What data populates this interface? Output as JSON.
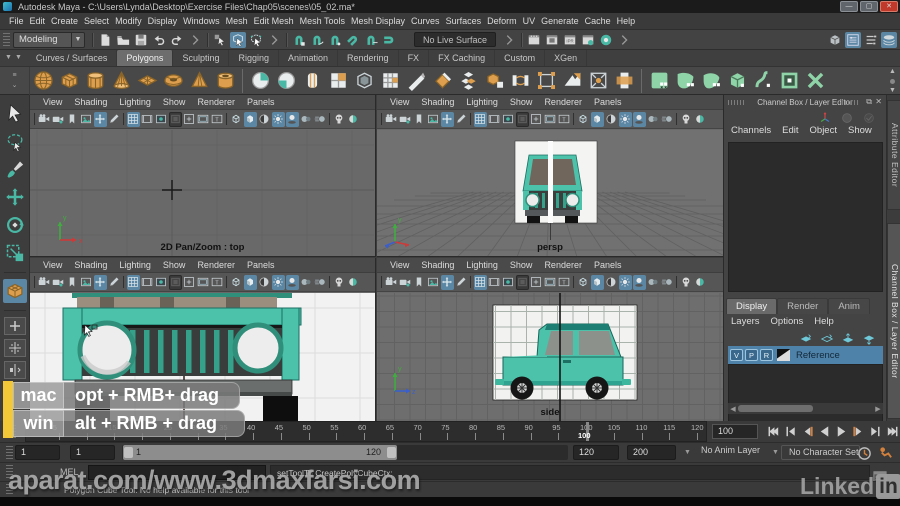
{
  "colors": {
    "teal": "#49b8a5",
    "car_teal": "#4cc2aa",
    "accent_blue": "#5b87a5",
    "orange": "#dd9e4d",
    "overlay_yellow": "#f2c738"
  },
  "title_bar": {
    "app_icon": "maya-logo",
    "title": "Autodesk Maya - C:\\Users\\Lynda\\Desktop\\Exercise Files\\Chap05\\scenes\\05_02.ma*",
    "window_buttons": [
      "minimize",
      "maximize",
      "close"
    ]
  },
  "menu_bar": {
    "items": [
      "File",
      "Edit",
      "Create",
      "Select",
      "Modify",
      "Display",
      "Windows",
      "Mesh",
      "Edit Mesh",
      "Mesh Tools",
      "Mesh Display",
      "Curves",
      "Surfaces",
      "Deform",
      "UV",
      "Generate",
      "Cache",
      "Help"
    ]
  },
  "status_line": {
    "menu_set": "Modeling",
    "live_surface_label": "No Live Surface",
    "file_icons": [
      {
        "n": "sep"
      },
      {
        "n": "file-new"
      },
      {
        "n": "folder-open"
      },
      {
        "n": "save"
      },
      {
        "n": "undo"
      },
      {
        "n": "redo"
      },
      {
        "n": "sep-arrow"
      },
      {
        "n": "sep"
      },
      {
        "n": "select-hierarchy"
      },
      {
        "n": "select-object",
        "h": 1
      },
      {
        "n": "select-component"
      },
      {
        "n": "sep-arrow"
      },
      {
        "n": "sep"
      },
      {
        "n": "snap-grid"
      },
      {
        "n": "snap-curve"
      },
      {
        "n": "snap-point"
      },
      {
        "n": "snap-proj"
      },
      {
        "n": "snap-view"
      },
      {
        "n": "make-live"
      }
    ],
    "render_icons": [
      {
        "n": "sep-arrow"
      },
      {
        "n": "sep"
      },
      {
        "n": "render-frame"
      },
      {
        "n": "render-region"
      },
      {
        "n": "ipr-render"
      },
      {
        "n": "render-settings"
      },
      {
        "n": "paint-effects"
      },
      {
        "n": "sep-arrow"
      }
    ],
    "right_icons": [
      {
        "n": "modeling-toolkit"
      },
      {
        "n": "attribute-editor-toggle",
        "h": 1
      },
      {
        "n": "channel-box-toggle"
      },
      {
        "n": "display-layers",
        "h": 1
      }
    ]
  },
  "shelf": {
    "tabs": [
      {
        "label": "Curves / Surfaces",
        "active": false
      },
      {
        "label": "Polygons",
        "active": true
      },
      {
        "label": "Sculpting",
        "active": false
      },
      {
        "label": "Rigging",
        "active": false
      },
      {
        "label": "Animation",
        "active": false
      },
      {
        "label": "Rendering",
        "active": false
      },
      {
        "label": "FX",
        "active": false
      },
      {
        "label": "FX Caching",
        "active": false
      },
      {
        "label": "Custom",
        "active": false
      },
      {
        "label": "XGen",
        "active": false
      }
    ],
    "icons": [
      {
        "n": "poly-sphere"
      },
      {
        "n": "poly-cube"
      },
      {
        "n": "poly-cylinder"
      },
      {
        "n": "poly-cone"
      },
      {
        "n": "poly-plane"
      },
      {
        "n": "poly-torus"
      },
      {
        "n": "poly-pyramid"
      },
      {
        "n": "poly-pipe"
      },
      {
        "n": "sep"
      },
      {
        "n": "combine"
      },
      {
        "n": "separate"
      },
      {
        "n": "split-edge"
      },
      {
        "n": "fill-hole"
      },
      {
        "n": "smooth"
      },
      {
        "n": "append-poly"
      },
      {
        "n": "insert-edge"
      },
      {
        "n": "bevel"
      },
      {
        "n": "stack-planes"
      },
      {
        "n": "cube-extract"
      },
      {
        "n": "bridge"
      },
      {
        "n": "edit-handles"
      },
      {
        "n": "fold"
      },
      {
        "n": "target-weld"
      },
      {
        "n": "multi-cut"
      },
      {
        "n": "sep"
      },
      {
        "n": "smooth-mesh"
      },
      {
        "n": "sculpt-tool"
      },
      {
        "n": "relax-tool"
      },
      {
        "n": "cube-green"
      },
      {
        "n": "curve-warp"
      },
      {
        "n": "uv-window"
      },
      {
        "n": "cross-tool"
      }
    ]
  },
  "toolbox": {
    "tools": [
      {
        "n": "select-tool"
      },
      {
        "n": "lasso-tool"
      },
      {
        "n": "paint-select-tool"
      },
      {
        "n": "move-tool"
      },
      {
        "n": "rotate-tool"
      },
      {
        "n": "scale-tool"
      },
      {
        "n": "last-tool-poly-cube",
        "h": 1
      }
    ],
    "layouts": [
      {
        "n": "layout-single"
      },
      {
        "n": "layout-four"
      },
      {
        "n": "layout-two"
      }
    ]
  },
  "viewports": {
    "panel_menus": [
      "View",
      "Shading",
      "Lighting",
      "Show",
      "Renderer",
      "Panels"
    ],
    "toolbar_icons": [
      {
        "n": "sep"
      },
      {
        "n": "camera-select"
      },
      {
        "n": "camera-attrs"
      },
      {
        "n": "bookmark"
      },
      {
        "n": "image-plane"
      },
      {
        "n": "pan-zoom",
        "h": 1
      },
      {
        "n": "pencil"
      },
      {
        "n": "sep"
      },
      {
        "n": "grid",
        "h": 1
      },
      {
        "n": "film-gate"
      },
      {
        "n": "res-gate"
      },
      {
        "n": "gate-mask",
        "d": 1
      },
      {
        "n": "field-chart"
      },
      {
        "n": "safe-action"
      },
      {
        "n": "safe-title"
      },
      {
        "n": "sep"
      },
      {
        "n": "wire-cube"
      },
      {
        "n": "shaded-cube",
        "h": 1
      },
      {
        "n": "half-shade"
      },
      {
        "n": "lights",
        "h": 1
      },
      {
        "n": "shadows",
        "h": 1
      },
      {
        "n": "ao"
      },
      {
        "n": "motion-blur"
      },
      {
        "n": "sep"
      },
      {
        "n": "xray"
      },
      {
        "n": "xray-select"
      }
    ],
    "top_left": {
      "label": "2D Pan/Zoom : top"
    },
    "top_right": {
      "label": "persp"
    },
    "bottom_right": {
      "label": "side"
    }
  },
  "channel_box": {
    "header": "Channel Box / Layer Editor",
    "mini_icons": [
      {
        "n": "axis-manip"
      },
      {
        "n": "dim-circle1"
      },
      {
        "n": "dim-circle2"
      }
    ],
    "menus": [
      "Channels",
      "Edit",
      "Object",
      "Show"
    ],
    "tabs": [
      {
        "label": "Display",
        "active": true
      },
      {
        "label": "Render",
        "active": false
      },
      {
        "label": "Anim",
        "active": false
      }
    ],
    "layer_menus": [
      "Layers",
      "Options",
      "Help"
    ],
    "layer_icons": [
      {
        "n": "layer-new"
      },
      {
        "n": "layer-new-empty"
      },
      {
        "n": "layer-move-up"
      },
      {
        "n": "layer-move-down"
      }
    ],
    "layer": {
      "toggles": [
        "V",
        "P",
        "R"
      ],
      "name": "Reference"
    }
  },
  "side_tabs": {
    "items": [
      {
        "label": "Attribute Editor",
        "active": false
      },
      {
        "label": "Channel Box / Layer Editor",
        "active": true
      }
    ]
  },
  "overlay": {
    "rows": [
      {
        "key": "mac",
        "value": "opt + RMB+ drag"
      },
      {
        "key": "win",
        "value": "alt + RMB + drag"
      }
    ]
  },
  "timeline": {
    "tick_start": 5,
    "tick_end": 120,
    "tick_step": 5,
    "current_frame": 100,
    "current_frame_label": "100",
    "current_time_field": "100",
    "playback_icons": [
      {
        "n": "go-start"
      },
      {
        "n": "step-back"
      },
      {
        "n": "prev-key"
      },
      {
        "n": "play-back"
      },
      {
        "n": "play-fwd"
      },
      {
        "n": "next-key"
      },
      {
        "n": "step-fwd"
      },
      {
        "n": "go-end"
      }
    ]
  },
  "range_slider": {
    "field_min": "1",
    "field_start": "1",
    "range_start_label": "1",
    "range_end_label": "120",
    "field_end": "120",
    "field_max": "200",
    "anim_layer": "No Anim Layer",
    "character_set": "No Character Set"
  },
  "command_line": {
    "label": "MEL",
    "input_value": "",
    "result": "setToolTo CreatePolyCubeCtx;"
  },
  "help_line": {
    "text": "Polygon Cube Tool: No help available for this tool"
  },
  "watermark": {
    "center": "aparat.com/www.3dmaxfarsi.com",
    "brand": "Linked",
    "brand_badge": "in"
  }
}
